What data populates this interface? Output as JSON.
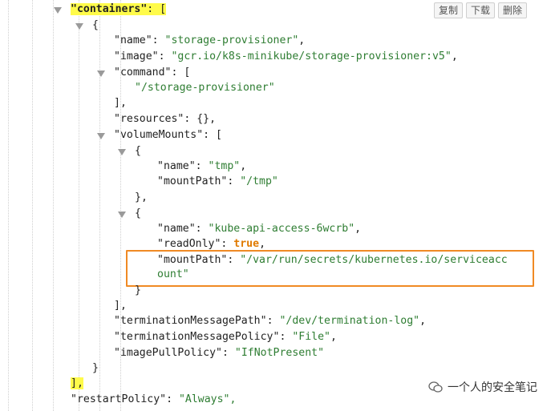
{
  "toolbar": {
    "copy": "复制",
    "download": "下载",
    "delete": "删除"
  },
  "json": {
    "containers_key": "\"containers\"",
    "containers_colon": ": [",
    "obj_open": "{",
    "name_key": "\"name\"",
    "name_val": "\"storage-provisioner\"",
    "image_key": "\"image\"",
    "image_val": "\"gcr.io/k8s-minikube/storage-provisioner:v5\"",
    "command_key": "\"command\"",
    "command_open": ": [",
    "command_item": "\"/storage-provisioner\"",
    "command_close": "],",
    "resources_key": "\"resources\"",
    "resources_val": ": {},",
    "volumeMounts_key": "\"volumeMounts\"",
    "volumeMounts_open": ": [",
    "vm1_open": "{",
    "vm1_name_key": "\"name\"",
    "vm1_name_val": "\"tmp\"",
    "vm1_mount_key": "\"mountPath\"",
    "vm1_mount_val": "\"/tmp\"",
    "vm1_close": "},",
    "vm2_open": "{",
    "vm2_name_key": "\"name\"",
    "vm2_name_val": "\"kube-api-access-6wcrb\"",
    "vm2_ro_key": "\"readOnly\"",
    "vm2_ro_val": "true",
    "vm2_mount_key": "\"mountPath\"",
    "vm2_mount_val_1": "\"/var/run/secrets/kubernetes.io/serviceacc",
    "vm2_mount_val_2": "ount\"",
    "vm2_close": "}",
    "volumeMounts_close": "],",
    "tmp_key": "\"terminationMessagePath\"",
    "tmp_val": "\"/dev/termination-log\"",
    "tmpol_key": "\"terminationMessagePolicy\"",
    "tmpol_val": "\"File\"",
    "ipp_key": "\"imagePullPolicy\"",
    "ipp_val": "\"IfNotPresent\"",
    "obj_close": "}",
    "containers_close": "],",
    "restart_key": "\"restartPolicy\"",
    "restart_val": "\"Always\","
  },
  "watermark": {
    "text": "一个人的安全笔记"
  },
  "colors": {
    "string": "#2e7d32",
    "boolean": "#e07a00",
    "highlight": "#fffb4a",
    "box": "#f08a24"
  }
}
